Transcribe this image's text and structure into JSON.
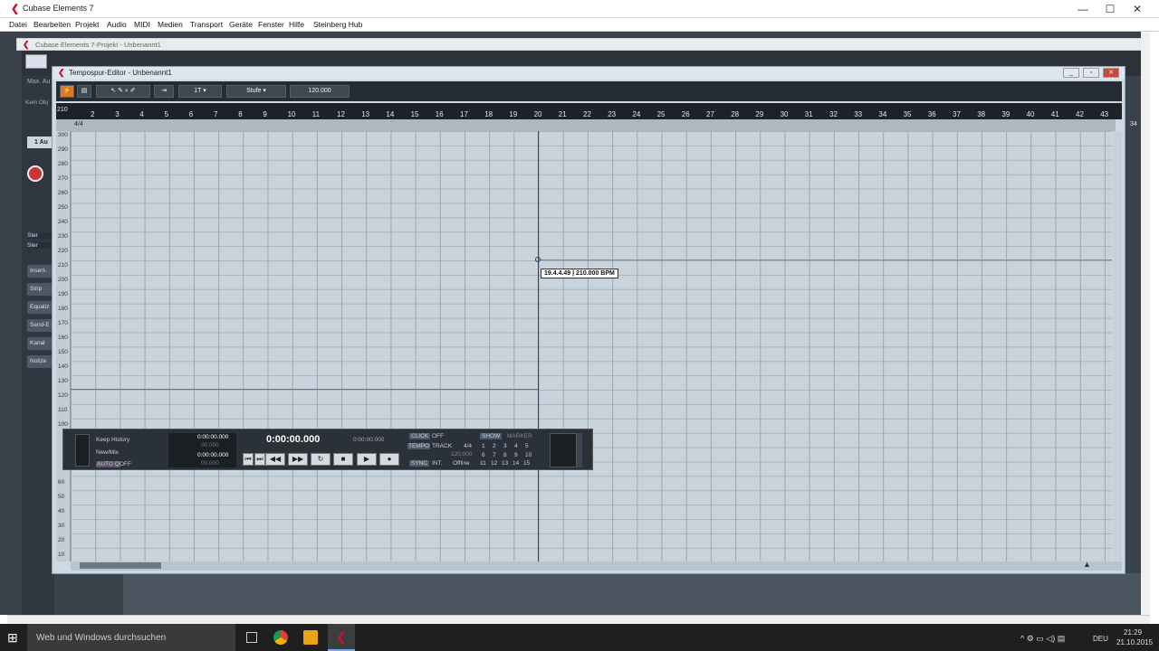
{
  "app": {
    "title": "Cubase Elements 7"
  },
  "menu": [
    "Datei",
    "Bearbeiten",
    "Projekt",
    "Audio",
    "MIDI",
    "Medien",
    "Transport",
    "Geräte",
    "Fenster",
    "Hilfe",
    "Steinberg Hub"
  ],
  "project": {
    "title": "Cubase Elements 7-Projekt - Unbenannt1",
    "left_label": "Max. Au",
    "kein_obj": "Kein Obj",
    "track_name": "1 Au",
    "panel_buttons": [
      "Insert-",
      "Strip",
      "Equaliz",
      "Send-E",
      "Kanal",
      "Notize"
    ],
    "stereo": [
      "Ster",
      "Ster"
    ]
  },
  "editor": {
    "title": "Tempospur-Editor - Unbenannt1",
    "toolbar": {
      "mode": "Stufe",
      "quantize": "1T",
      "tempo": "120.000"
    },
    "ruler_start": "210",
    "ruler": [
      "2",
      "3",
      "4",
      "5",
      "6",
      "7",
      "8",
      "9",
      "10",
      "11",
      "12",
      "13",
      "14",
      "15",
      "16",
      "17",
      "18",
      "19",
      "20",
      "21",
      "22",
      "23",
      "24",
      "25",
      "26",
      "27",
      "28",
      "29",
      "30",
      "31",
      "32",
      "33",
      "34",
      "35",
      "36",
      "37",
      "38",
      "39",
      "40",
      "41",
      "42",
      "43",
      "34"
    ],
    "time_signature": "4/4",
    "y_labels": [
      "300",
      "290",
      "280",
      "270",
      "260",
      "250",
      "240",
      "230",
      "220",
      "210",
      "200",
      "190",
      "180",
      "170",
      "160",
      "150",
      "140",
      "130",
      "120",
      "110",
      "100",
      "60",
      "50",
      "40",
      "30",
      "20",
      "10"
    ],
    "tooltip": "19.4.4.49 | 210.000 BPM"
  },
  "transport": {
    "history": "Keep History",
    "newmix": "New/Mix",
    "autoq": "AUTO Q",
    "autoq_val": "OFF",
    "time_left1": "0:00:00.000",
    "time_left2": "00.000",
    "time_left3": "0:00:00.000",
    "time_left4": "00.000",
    "main_time": "0:00:00.000",
    "sub_time": "0:00:00.000",
    "click": "CLICK",
    "click_val": "OFF",
    "tempo": "TEMPO",
    "tempo_mode": "TRACK",
    "sig": "4/4",
    "tempo_val": "120.000",
    "sync": "SYNC",
    "sync_int": "INT.",
    "sync_val": "Offline",
    "show": "SHOW",
    "marker": "MARKER",
    "markers": [
      "1",
      "2",
      "3",
      "4",
      "5",
      "6",
      "7",
      "8",
      "9",
      "10",
      "11",
      "12",
      "13",
      "14",
      "15"
    ]
  },
  "taskbar": {
    "search": "Web und Windows durchsuchen",
    "lang": "DEU",
    "time": "21:29",
    "date": "21.10.2015"
  }
}
